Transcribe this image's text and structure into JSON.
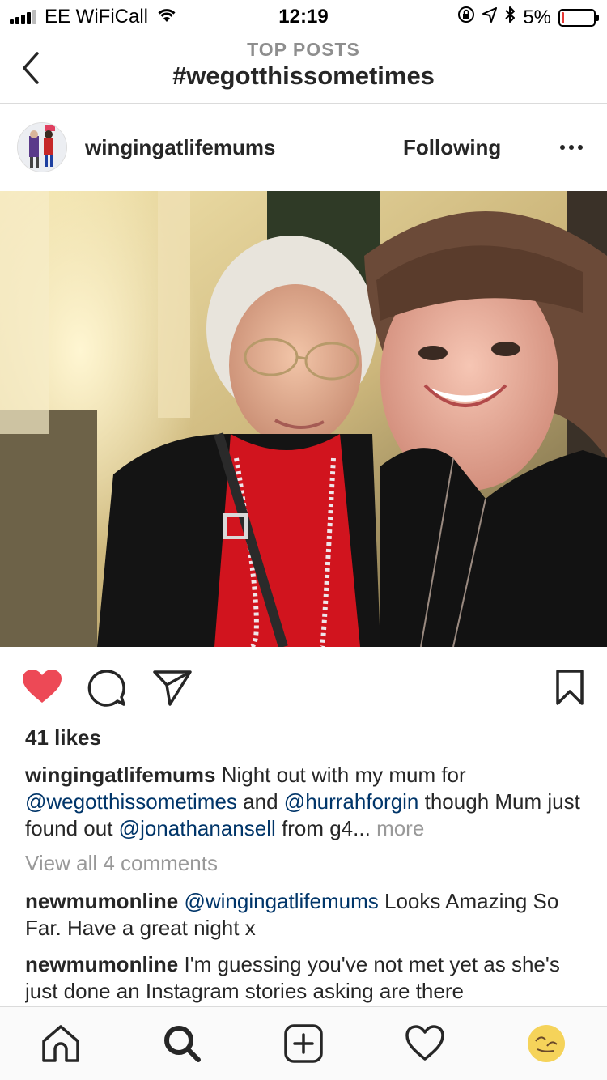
{
  "status_bar": {
    "carrier": "EE WiFiCall",
    "time": "12:19",
    "battery_percent": "5%",
    "battery_level": 0.05,
    "icons": [
      "signal-icon",
      "wifi-icon",
      "orientation-lock-icon",
      "location-icon",
      "bluetooth-icon",
      "battery-icon"
    ]
  },
  "header": {
    "subtitle": "TOP POSTS",
    "title": "#wegotthissometimes",
    "back_icon": "chevron-left-icon"
  },
  "post": {
    "username": "wingingatlifemums",
    "follow_label": "Following",
    "more_icon": "more-dots-icon",
    "photo_alt": "selfie photo",
    "liked": true,
    "like_color": "#ed4956",
    "likes": "41 likes",
    "caption": {
      "user": "wingingatlifemums",
      "text1": "Night out with my mum for",
      "mention1": "@wegotthissometimes",
      "text2": "and",
      "mention2": "@hurrahforgin",
      "text3": "though Mum just found out",
      "mention3": "@jonathanansell",
      "text4": "from g4...",
      "more": "more"
    },
    "view_all": "View all 4 comments",
    "comments": [
      {
        "user": "newmumonline",
        "mention": "@wingingatlifemums",
        "text": "Looks Amazing So Far. Have a great night x"
      },
      {
        "user": "newmumonline",
        "text": "I'm guessing you've not met yet as she's just done an Instagram stories asking are there"
      }
    ]
  },
  "tabbar": {
    "items": [
      "home-icon",
      "search-icon",
      "new-post-icon",
      "activity-heart-icon",
      "profile-avatar"
    ]
  }
}
